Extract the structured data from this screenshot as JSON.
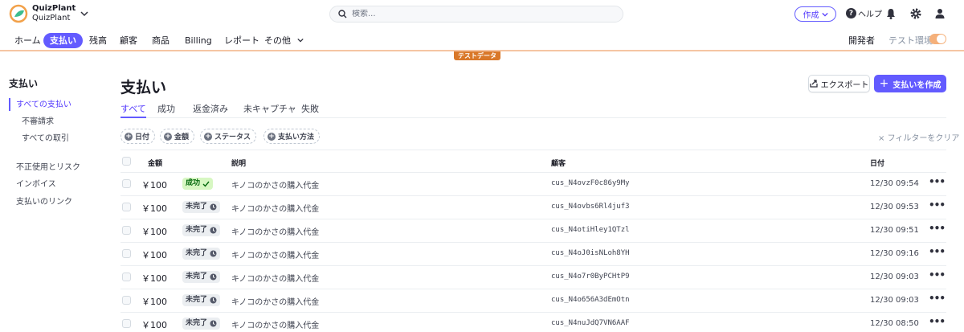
{
  "brand": {
    "line1": "QuizPlant",
    "line2": "QuizPlant"
  },
  "search": {
    "placeholder": "検索..."
  },
  "topbar": {
    "create_label": "作成",
    "help_label": "ヘルプ"
  },
  "nav": {
    "items": [
      "ホーム",
      "支払い",
      "残高",
      "顧客",
      "商品",
      "Billing",
      "レポート",
      "その他"
    ],
    "developer_label": "開発者",
    "test_env_label": "テスト環境",
    "test_data_badge": "テストデータ"
  },
  "sidebar": {
    "title": "支払い",
    "items": [
      "すべての支払い",
      "不審請求",
      "すべての取引",
      "不正使用とリスク",
      "インボイス",
      "支払いのリンク"
    ]
  },
  "page": {
    "title": "支払い",
    "export_label": "エクスポート",
    "create_payment_label": "支払いを作成"
  },
  "tabs": [
    "すべて",
    "成功",
    "返金済み",
    "未キャプチャ",
    "失敗"
  ],
  "filters": {
    "chips": [
      "日付",
      "金額",
      "ステータス",
      "支払い方法"
    ],
    "clear_label": "フィルターをクリア"
  },
  "table": {
    "headers": {
      "amount": "金額",
      "description": "説明",
      "customer": "顧客",
      "date": "日付"
    },
    "rows": [
      {
        "amount": "￥100",
        "status": "成功",
        "status_type": "success",
        "description": "キノコのかさの購入代金",
        "customer": "cus_N4ovzF0c86y9My",
        "date": "12/30 09:54"
      },
      {
        "amount": "￥100",
        "status": "未完了",
        "status_type": "pending",
        "description": "キノコのかさの購入代金",
        "customer": "cus_N4ovbs6Rl4juf3",
        "date": "12/30 09:53"
      },
      {
        "amount": "￥100",
        "status": "未完了",
        "status_type": "pending",
        "description": "キノコのかさの購入代金",
        "customer": "cus_N4otiHley1QTzl",
        "date": "12/30 09:51"
      },
      {
        "amount": "￥100",
        "status": "未完了",
        "status_type": "pending",
        "description": "キノコのかさの購入代金",
        "customer": "cus_N4oJ0isNLoh8YH",
        "date": "12/30 09:16"
      },
      {
        "amount": "￥100",
        "status": "未完了",
        "status_type": "pending",
        "description": "キノコのかさの購入代金",
        "customer": "cus_N4o7r0ByPCHtP9",
        "date": "12/30 09:03"
      },
      {
        "amount": "￥100",
        "status": "未完了",
        "status_type": "pending",
        "description": "キノコのかさの購入代金",
        "customer": "cus_N4o656A3dEmOtn",
        "date": "12/30 09:03"
      },
      {
        "amount": "￥100",
        "status": "未完了",
        "status_type": "pending",
        "description": "キノコのかさの購入代金",
        "customer": "cus_N4nuJdQ7VN6AAF",
        "date": "12/30 08:50"
      }
    ]
  },
  "colors": {
    "accent": "#635bff",
    "test_badge": "#d97829",
    "success_bg": "#d7f7c2",
    "success_fg": "#05690d"
  }
}
